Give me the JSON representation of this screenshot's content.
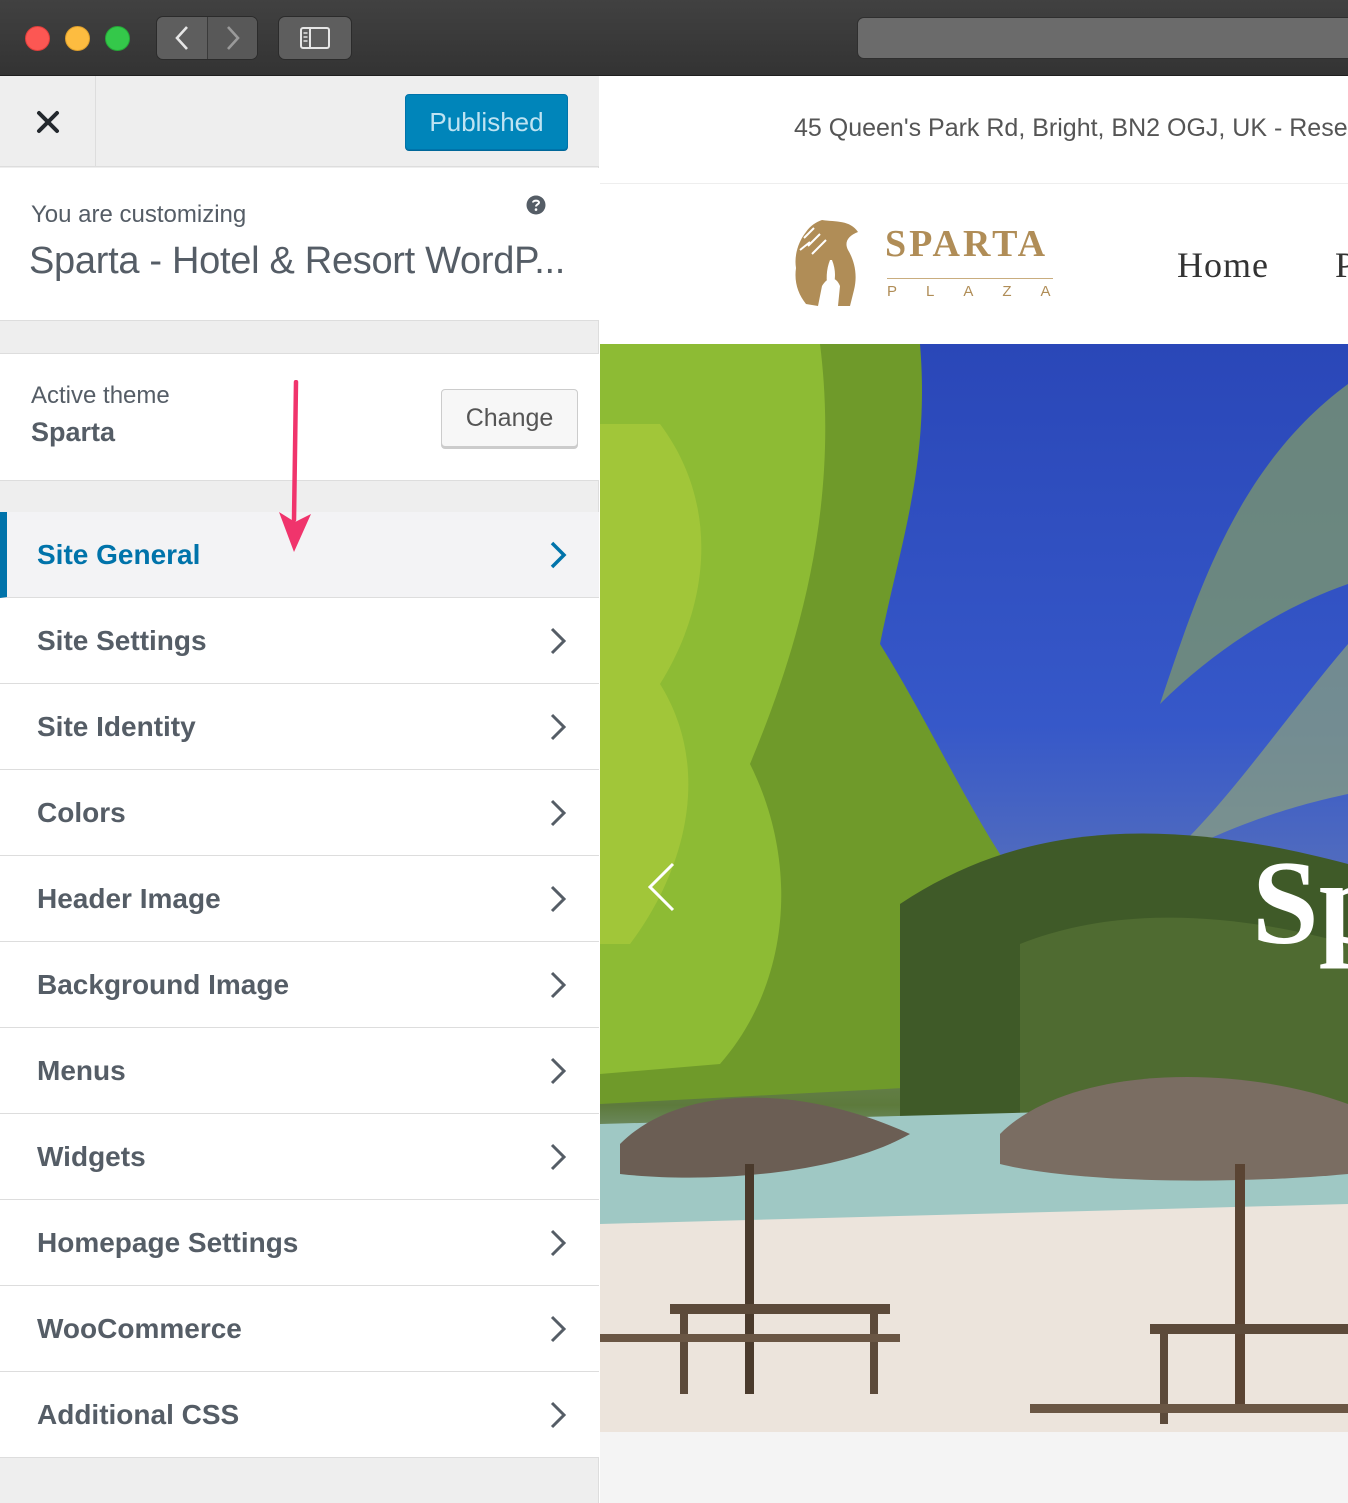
{
  "browser": {
    "back_icon": "chevron-left-icon",
    "forward_icon": "chevron-right-icon",
    "sidebar_icon": "sidebar-icon"
  },
  "customizer": {
    "close_icon": "close-icon",
    "publish_label": "Published",
    "customizing_label": "You are customizing",
    "site_title": "Sparta - Hotel & Resort WordP...",
    "help_icon": "question-circle-icon",
    "active_theme_label": "Active theme",
    "active_theme_name": "Sparta",
    "change_label": "Change",
    "sections": [
      {
        "label": "Site General",
        "active": true
      },
      {
        "label": "Site Settings"
      },
      {
        "label": "Site Identity"
      },
      {
        "label": "Colors"
      },
      {
        "label": "Header Image"
      },
      {
        "label": "Background Image"
      },
      {
        "label": "Menus"
      },
      {
        "label": "Widgets"
      },
      {
        "label": "Homepage Settings"
      },
      {
        "label": "WooCommerce"
      },
      {
        "label": "Additional CSS"
      }
    ]
  },
  "preview": {
    "address": "45 Queen's Park Rd, Bright, BN2 OGJ, UK  -  Rese",
    "brand": "SPARTA",
    "brand_sub": "PLAZA",
    "menu": [
      "Home",
      "P"
    ],
    "hero_text": "Sp",
    "hero_prev_icon": "chevron-left-icon"
  },
  "colors": {
    "accent": "#0073aa",
    "publish_bg": "#0085ba",
    "annotation_arrow": "#f0346c",
    "brand_gold": "#b08d57"
  }
}
